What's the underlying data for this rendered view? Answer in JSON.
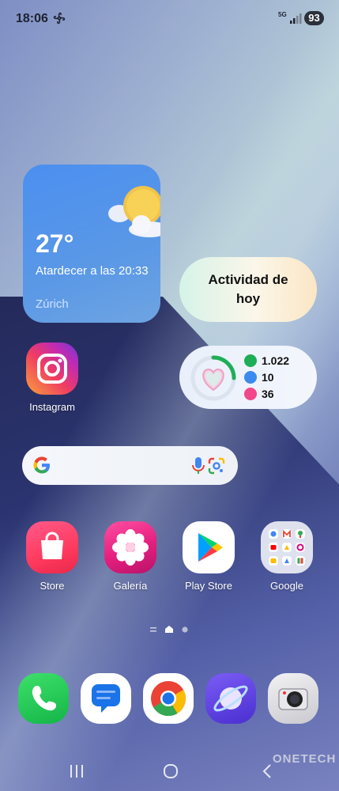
{
  "status_bar": {
    "time": "18:06",
    "network": "5G",
    "battery": "93"
  },
  "weather_widget": {
    "temperature": "27°",
    "description": "Atardecer a las 20:33",
    "city": "Zúrich",
    "icon": "sun-cloud-icon"
  },
  "activity_widget": {
    "label": "Actividad de hoy"
  },
  "health_widget": {
    "steps": "1.022",
    "active_minutes": "10",
    "calories": "36"
  },
  "apps": {
    "instagram": "Instagram",
    "store": "Store",
    "galeria": "Galería",
    "play_store": "Play Store",
    "google": "Google"
  },
  "search_bar": {
    "icon": "google-g-icon"
  },
  "page_indicator": {
    "pages": 2,
    "current": 1
  },
  "dock": [
    "phone-icon",
    "messages-icon",
    "chrome-icon",
    "internet-icon",
    "camera-icon"
  ],
  "watermark": "ONETECH",
  "colors": {
    "weather_bg": "#4b8ff0",
    "steps_green": "#1fae58",
    "minutes_blue": "#3b8af0",
    "calories_pink": "#f2478a"
  }
}
